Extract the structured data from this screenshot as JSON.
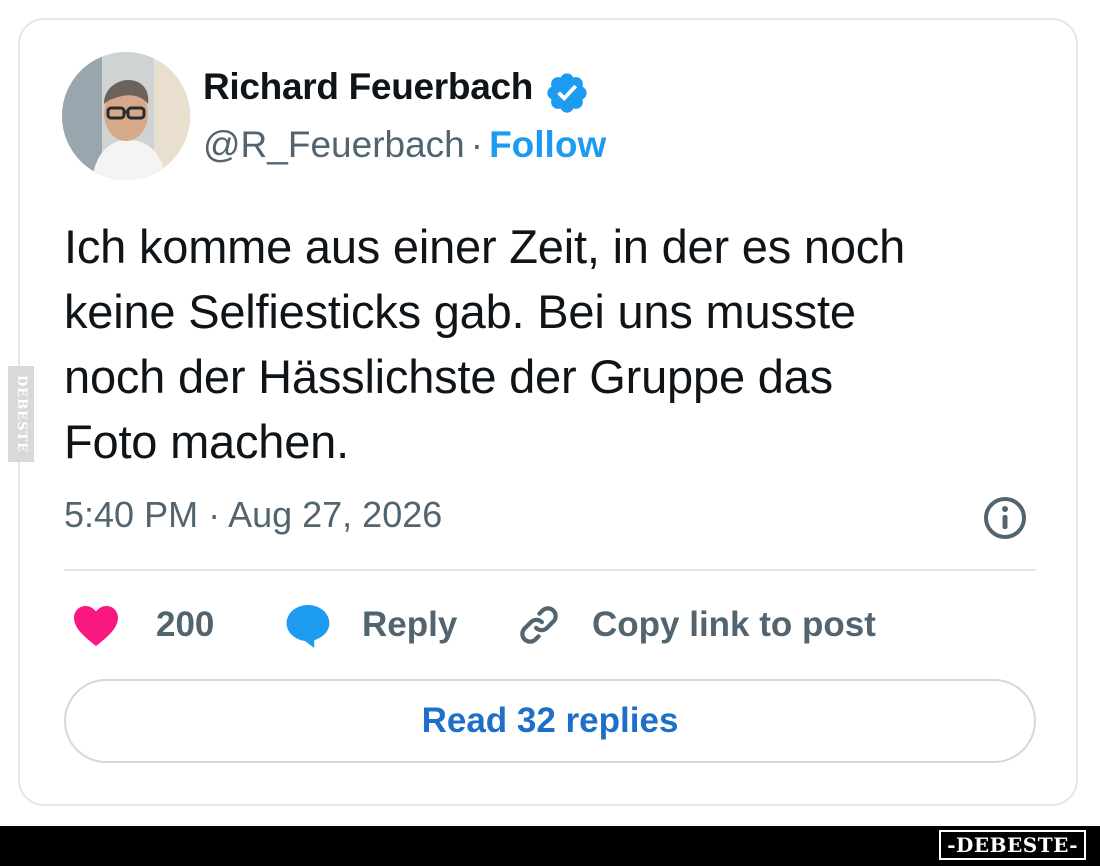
{
  "author": {
    "name": "Richard Feuerbach",
    "handle": "@R_Feuerbach",
    "separator": "·",
    "follow_label": "Follow",
    "verified": true
  },
  "tweet": {
    "lines": [
      "Ich komme aus einer Zeit, in der es noch",
      "keine Selfiesticks gab. Bei uns musste",
      "noch der Hässlichste der Gruppe das",
      "Foto machen."
    ],
    "timestamp": "5:40 PM · Aug 27, 2026"
  },
  "actions": {
    "like_count": "200",
    "reply_label": "Reply",
    "copy_label": "Copy link to post"
  },
  "read_replies_label": "Read 32 replies",
  "watermarks": {
    "side": "DEBESTE",
    "footer": "-DEBESTE-"
  },
  "colors": {
    "accent": "#1d9bf0",
    "heart": "#f91880",
    "reply_bubble": "#1d9bf0",
    "secondary_text": "#536471",
    "border": "#e1e8ed"
  },
  "icons": [
    "verified-badge-icon",
    "info-icon",
    "heart-icon",
    "reply-bubble-icon",
    "link-icon"
  ]
}
